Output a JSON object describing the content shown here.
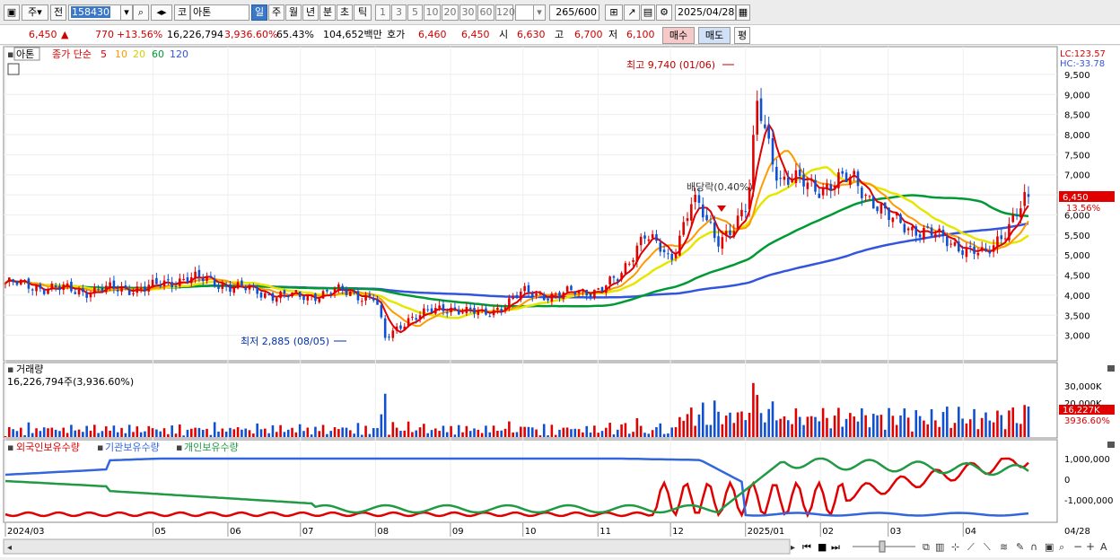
{
  "toolbar": {
    "mode1": "주",
    "mode2": "전",
    "code": "158430",
    "market": "코",
    "name": "아톤",
    "periods": [
      "일",
      "주",
      "월",
      "년",
      "분",
      "초",
      "틱"
    ],
    "numbers": [
      "1",
      "3",
      "5",
      "10",
      "20",
      "30",
      "60",
      "120"
    ],
    "count": "265",
    "count_max": "/600",
    "date": "2025/04/28"
  },
  "quote": {
    "price": "6,450",
    "change": "770",
    "change_pct": "+13.56%",
    "volume": "16,226,794",
    "volume_pct": "3,936.60%",
    "turnover_pct": "65.43%",
    "amount": "104,652백만",
    "bid_label": "호가",
    "bid1": "6,460",
    "bid2": "6,450",
    "open_label": "시",
    "open": "6,630",
    "high_label": "고",
    "high": "6,700",
    "low_label": "저",
    "low": "6,100",
    "buy": "매수",
    "sell": "매도",
    "eval": "평"
  },
  "price_panel": {
    "name": "아톤",
    "legend_prefix": "종가 단순",
    "ma": [
      {
        "period": "5",
        "color": "#e00000"
      },
      {
        "period": "10",
        "color": "#ff9900"
      },
      {
        "period": "20",
        "color": "#e6e600"
      },
      {
        "period": "60",
        "color": "#009933"
      },
      {
        "period": "120",
        "color": "#3355dd"
      }
    ],
    "lc": "LC:123.57",
    "hc": "HC:-33.78",
    "high_note": "최고 9,740 (01/06)",
    "low_note": "최저 2,885 (08/05)",
    "dividend_note": "배당락(0.40%)",
    "last_price": "6,450",
    "last_pct": "13.56%"
  },
  "volume_panel": {
    "title": "거래량",
    "value": "16,226,794주(3,936.60%)",
    "last": "16,227K",
    "last_pct": "3936.60%"
  },
  "holdings_panel": {
    "legend": [
      "외국인보유수량",
      "기관보유수량",
      "개인보유수량"
    ],
    "colors": [
      "#e00000",
      "#3366dd",
      "#229944"
    ]
  },
  "x_labels": [
    "2024/03",
    "05",
    "06",
    "07",
    "08",
    "09",
    "10",
    "11",
    "12",
    "2025/01",
    "02",
    "03",
    "04",
    "04/28"
  ],
  "chart_data": [
    {
      "type": "candlestick",
      "title": "아톤",
      "y_ticks": [
        3000,
        3500,
        4000,
        4500,
        5000,
        5500,
        6000,
        6500,
        7000,
        7500,
        8000,
        8500,
        9000,
        9500
      ],
      "ylim": [
        2500,
        9900
      ],
      "months": [
        "2024/03",
        "04",
        "05",
        "06",
        "07",
        "08",
        "09",
        "10",
        "11",
        "12",
        "2025/01",
        "02",
        "03",
        "04"
      ],
      "close_path": [
        [
          "2024/03",
          4300
        ],
        [
          "2024/04",
          4100
        ],
        [
          "2024/05",
          4200
        ],
        [
          "2024/05/15",
          4450
        ],
        [
          "2024/06",
          4250
        ],
        [
          "2024/06/15",
          4050
        ],
        [
          "2024/07",
          3950
        ],
        [
          "2024/07/15",
          4100
        ],
        [
          "2024/08/01",
          3950
        ],
        [
          "2024/08/05",
          2885
        ],
        [
          "2024/08/15",
          3450
        ],
        [
          "2024/09",
          3700
        ],
        [
          "2024/09/15",
          3500
        ],
        [
          "2024/10",
          4050
        ],
        [
          "2024/10/15",
          4000
        ],
        [
          "2024/11",
          4150
        ],
        [
          "2024/11/10",
          4400
        ],
        [
          "2024/11/20",
          5600
        ],
        [
          "2024/12",
          4800
        ],
        [
          "2024/12/10",
          6500
        ],
        [
          "2024/12/20",
          5300
        ],
        [
          "2025/01/02",
          6200
        ],
        [
          "2025/01/06",
          8800
        ],
        [
          "2025/01/15",
          6900
        ],
        [
          "2025/02",
          6700
        ],
        [
          "2025/02/15",
          6900
        ],
        [
          "2025/03",
          5900
        ],
        [
          "2025/03/15",
          5600
        ],
        [
          "2025/04",
          5200
        ],
        [
          "2025/04/10",
          4950
        ],
        [
          "2025/04/20",
          5800
        ],
        [
          "2025/04/28",
          6450
        ]
      ],
      "high": 9740,
      "low": 2885,
      "last": 6450
    },
    {
      "type": "bar",
      "title": "거래량",
      "y_ticks": [
        "20,000K",
        "30,000K"
      ],
      "last": 16227
    },
    {
      "type": "line",
      "y_ticks": [
        "-1,000,000",
        "0",
        "1,000,000"
      ],
      "series": [
        {
          "name": "외국인보유수량"
        },
        {
          "name": "기관보유수량"
        },
        {
          "name": "개인보유수량"
        }
      ]
    }
  ]
}
